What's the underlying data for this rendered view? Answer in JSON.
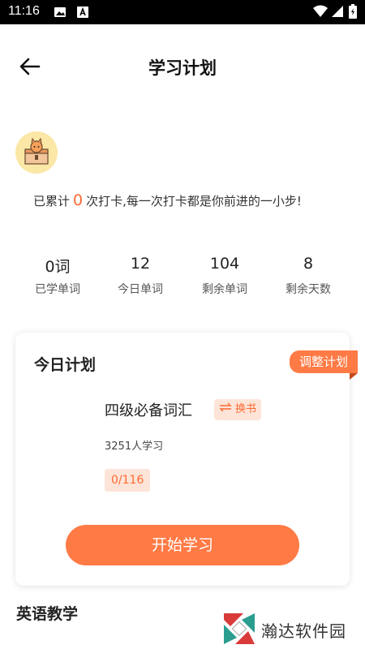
{
  "status_bar": {
    "time": "11:16"
  },
  "header": {
    "title": "学习计划"
  },
  "checkin": {
    "prefix": "已累计",
    "count": "0",
    "suffix": "次打卡,每一次打卡都是你前进的一小步!"
  },
  "stats": [
    {
      "value": "0词",
      "label": "已学单词"
    },
    {
      "value": "12",
      "label": "今日单词"
    },
    {
      "value": "104",
      "label": "剩余单词"
    },
    {
      "value": "8",
      "label": "剩余天数"
    }
  ],
  "plan": {
    "title": "今日计划",
    "adjust_label": "调整计划",
    "book_name": "四级必备词汇",
    "switch_label": "换书",
    "learners": "3251人学习",
    "progress": "0/116",
    "start_label": "开始学习"
  },
  "section": {
    "title": "英语教学"
  },
  "watermark": {
    "text": "瀚达软件园"
  },
  "colors": {
    "accent": "#ff7a45",
    "accent_text": "#ff6a33",
    "badge_bg": "#fde4d8"
  }
}
